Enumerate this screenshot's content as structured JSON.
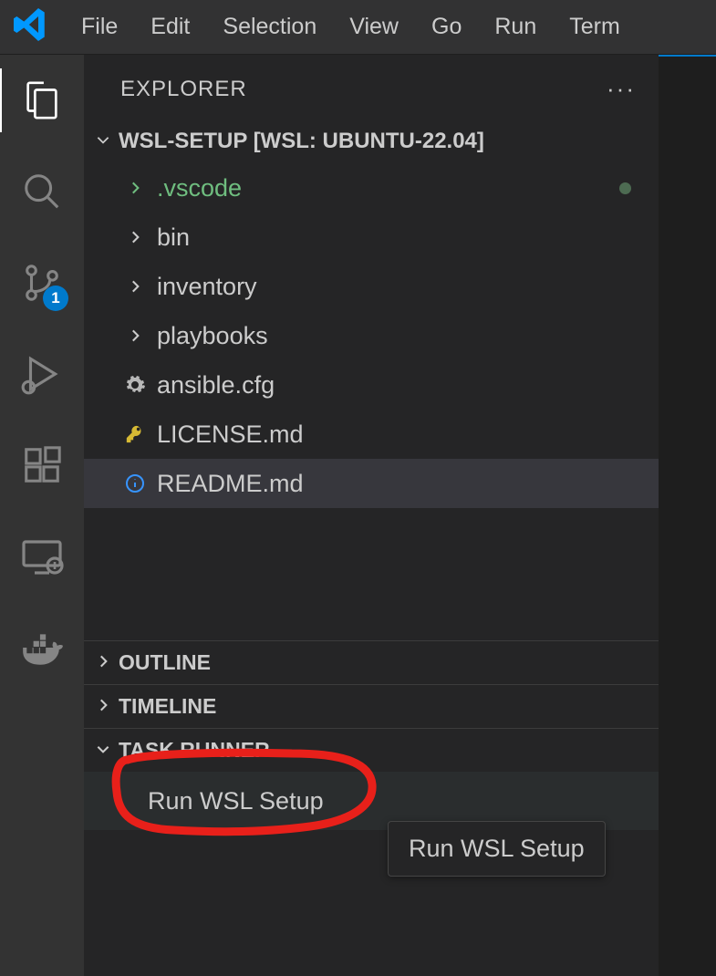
{
  "menubar": {
    "items": [
      "File",
      "Edit",
      "Selection",
      "View",
      "Go",
      "Run",
      "Term"
    ]
  },
  "activitybar": {
    "scm_badge": "1"
  },
  "explorer": {
    "title": "EXPLORER",
    "root_label": "WSL-SETUP [WSL: UBUNTU-22.04]",
    "tree": [
      {
        "label": ".vscode",
        "kind": "folder",
        "green": true,
        "dot": true
      },
      {
        "label": "bin",
        "kind": "folder"
      },
      {
        "label": "inventory",
        "kind": "folder"
      },
      {
        "label": "playbooks",
        "kind": "folder"
      },
      {
        "label": "ansible.cfg",
        "kind": "gear"
      },
      {
        "label": "LICENSE.md",
        "kind": "key"
      },
      {
        "label": "README.md",
        "kind": "info",
        "selected": true
      }
    ],
    "sections": {
      "outline": "OUTLINE",
      "timeline": "TIMELINE",
      "task_runner": "TASK RUNNER"
    },
    "task_item": "Run WSL Setup"
  },
  "tooltip": "Run WSL Setup"
}
